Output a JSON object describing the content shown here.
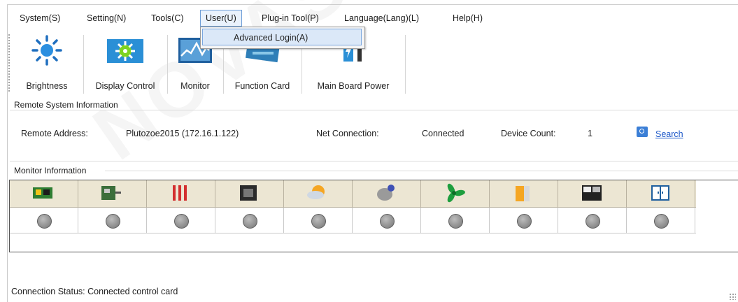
{
  "menu": {
    "items": [
      "System(S)",
      "Setting(N)",
      "Tools(C)",
      "User(U)",
      "Plug-in Tool(P)",
      "Language(Lang)(L)",
      "Help(H)"
    ],
    "open_menu_item": "Advanced Login(A)"
  },
  "toolbar": {
    "buttons": [
      {
        "label": "Brightness",
        "icon": "brightness-icon"
      },
      {
        "label": "Display Control",
        "icon": "display-control-icon"
      },
      {
        "label": "Monitor",
        "icon": "monitor-icon"
      },
      {
        "label": "Function Card",
        "icon": "function-card-icon"
      },
      {
        "label": "Main Board Power",
        "icon": "main-board-power-icon"
      }
    ]
  },
  "remote": {
    "group_title": "Remote System Information",
    "address_label": "Remote Address:",
    "address_value": "Plutozoe2015 (172.16.1.122)",
    "net_label": "Net Connection:",
    "net_value": "Connected",
    "device_label": "Device Count:",
    "device_value": "1",
    "search_label": "Search"
  },
  "monitor": {
    "group_title": "Monitor Information",
    "columns": [
      "receiving-card-icon",
      "control-card-icon",
      "temperature-icon",
      "chip-icon",
      "weather-humidity-icon",
      "smoke-sensor-icon",
      "fan-icon",
      "power-battery-icon",
      "cabinet-door-icon",
      "door-panel-icon"
    ],
    "status_colors": [
      "#8a8a8a"
    ]
  },
  "status": {
    "text": "Connection Status:  Connected control card"
  },
  "watermark": "NOVAS"
}
